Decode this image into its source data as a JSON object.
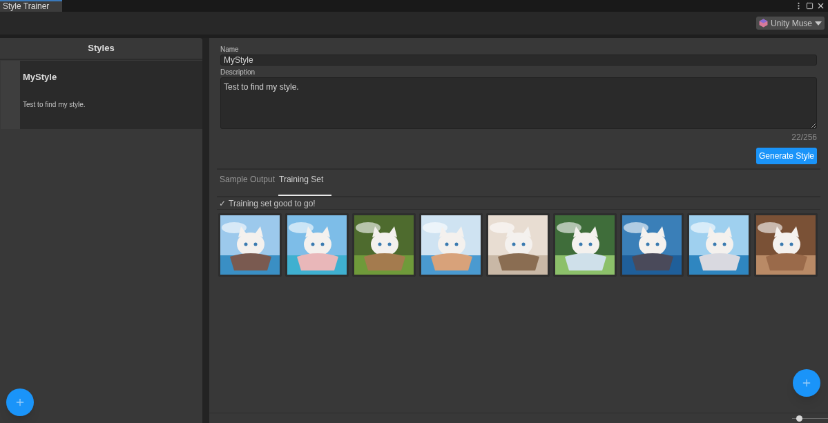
{
  "window": {
    "title": "Style Trainer"
  },
  "toolbar": {
    "account": "Unity Muse"
  },
  "sidebar": {
    "title": "Styles",
    "items": [
      {
        "name": "MyStyle",
        "description": "Test to find my style.",
        "selected": true
      }
    ]
  },
  "form": {
    "name_label": "Name",
    "name": "MyStyle",
    "description_label": "Description",
    "description": "Test to find my style.",
    "counter": "22/256",
    "generate_button": "Generate Style"
  },
  "tabs": [
    {
      "label": "Sample Output",
      "selected": false
    },
    {
      "label": "Training Set",
      "selected": true
    }
  ],
  "status": {
    "icon": "✓",
    "text": "Training set good to go!"
  },
  "zoom_slider": {
    "level": 0.2
  }
}
